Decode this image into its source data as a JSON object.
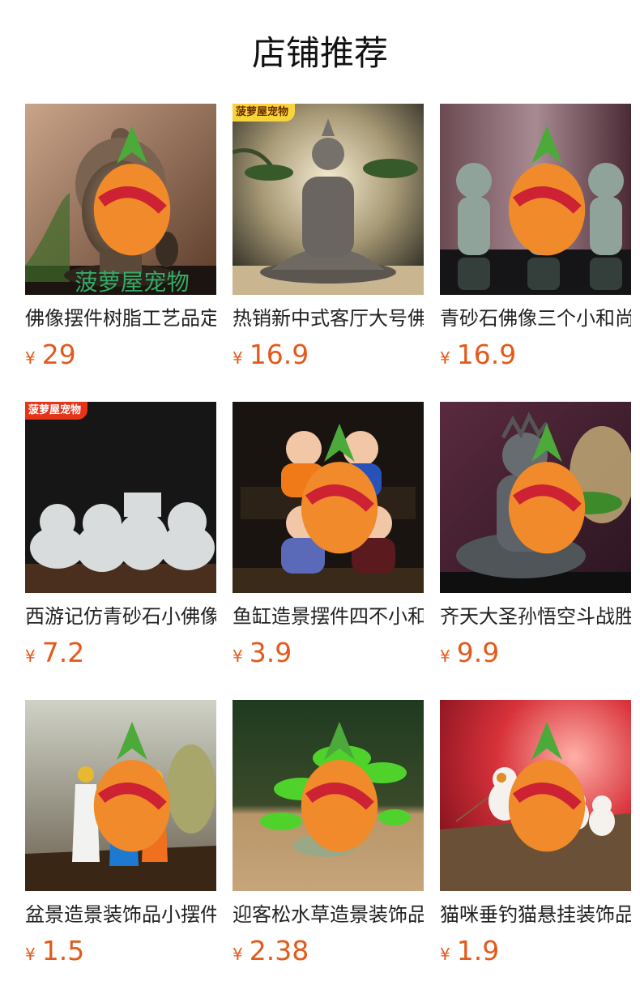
{
  "title": "店铺推荐",
  "currency": "¥",
  "products": [
    {
      "name": "佛像摆件树脂工艺品定",
      "price": "29",
      "icon": "buddha-head-image",
      "badge": ""
    },
    {
      "name": "热销新中式客厅大号佛",
      "price": "16.9",
      "icon": "seated-buddha-image",
      "badge": "菠萝屋宠物"
    },
    {
      "name": "青砂石佛像三个小和尚",
      "price": "16.9",
      "icon": "three-monks-image",
      "badge": ""
    },
    {
      "name": "西游记仿青砂石小佛像",
      "price": "7.2",
      "icon": "journey-west-figures-image",
      "badge": "菠萝屋宠物"
    },
    {
      "name": "鱼缸造景摆件四不小和",
      "price": "3.9",
      "icon": "four-little-monks-image",
      "badge": ""
    },
    {
      "name": "齐天大圣孙悟空斗战胜",
      "price": "9.9",
      "icon": "monkey-king-image",
      "badge": ""
    },
    {
      "name": "盆景造景装饰品小摆件",
      "price": "1.5",
      "icon": "robed-figures-image",
      "badge": ""
    },
    {
      "name": "迎客松水草造景装饰品",
      "price": "2.38",
      "icon": "pine-tree-image",
      "badge": ""
    },
    {
      "name": "猫咪垂钓猫悬挂装饰品",
      "price": "1.9",
      "icon": "fishing-cats-image",
      "badge": ""
    }
  ]
}
